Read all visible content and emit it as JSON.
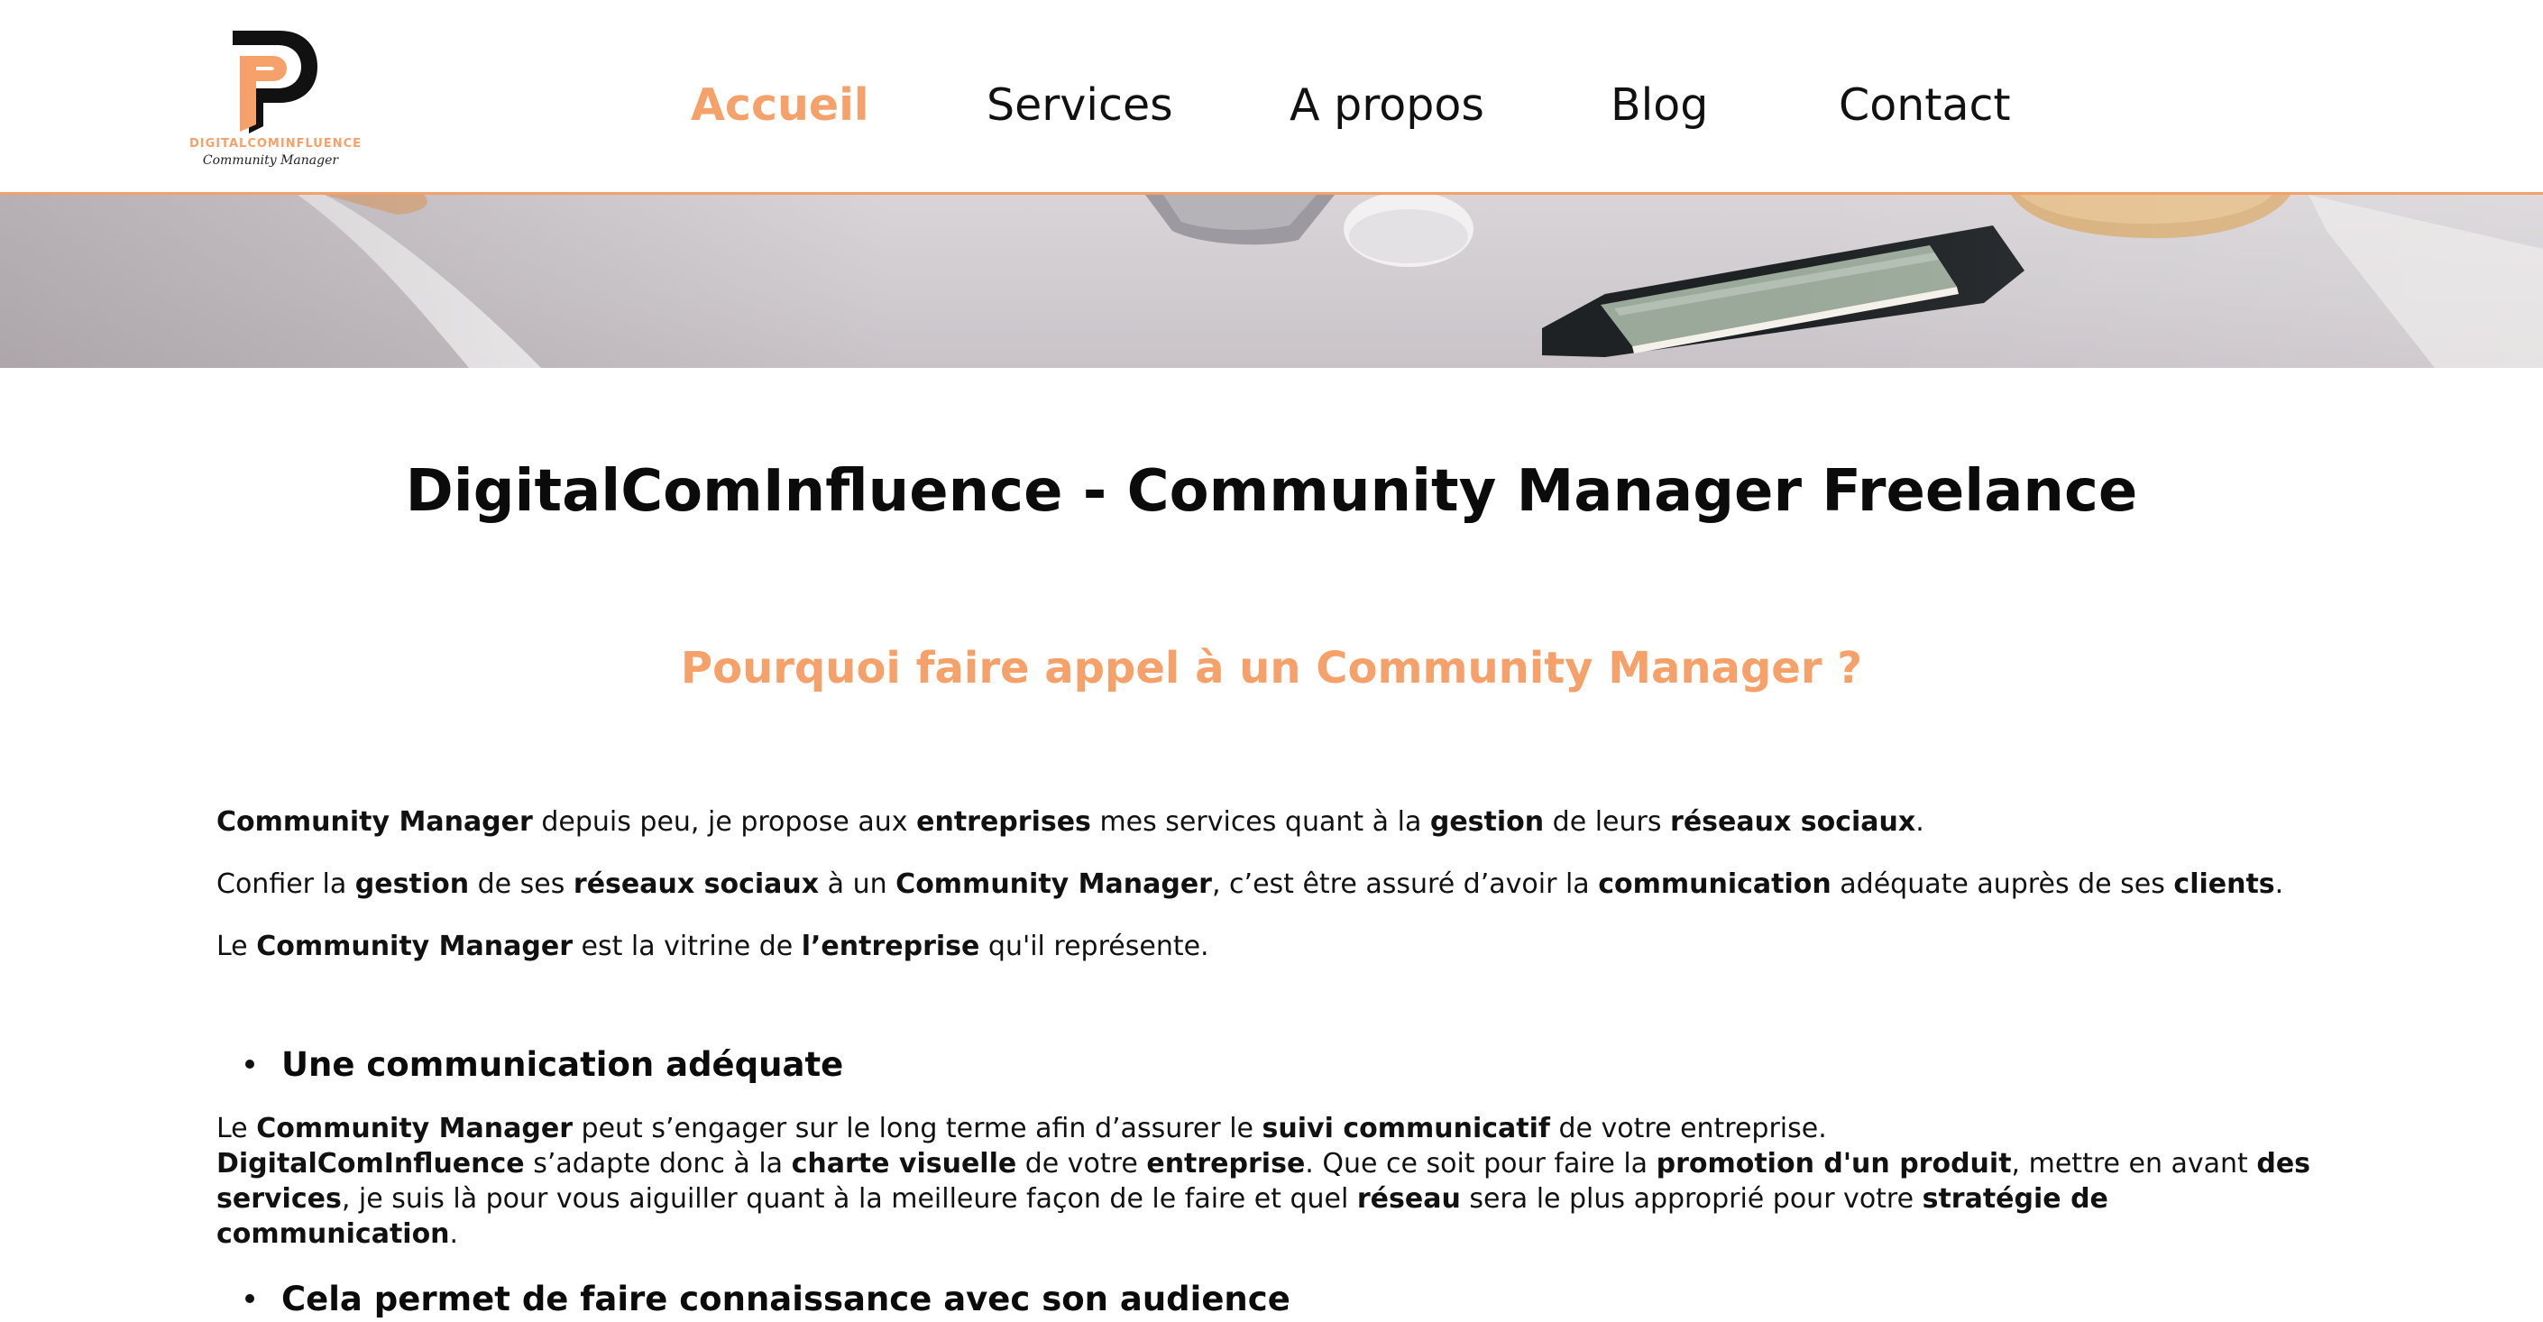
{
  "header": {
    "logo": {
      "brand": "DIGITALCOMINFLUENCE",
      "tagline": "Community Manager",
      "colors": {
        "primary": "#111111",
        "accent": "#f6a06a"
      }
    },
    "nav": [
      {
        "label": "Accueil",
        "active": true
      },
      {
        "label": "Services",
        "active": false
      },
      {
        "label": "A propos",
        "active": false
      },
      {
        "label": "Blog",
        "active": false
      },
      {
        "label": "Contact",
        "active": false
      }
    ]
  },
  "colors": {
    "accent": "#f6a06a",
    "text": "#111111",
    "background": "#ffffff"
  },
  "hero": {
    "image": "desk-photo-with-notebook-and-mouse"
  },
  "main": {
    "title": "DigitalComInfluence - Community Manager Freelance",
    "subtitle": "Pourquoi faire appel à un Community Manager ?",
    "intro": [
      [
        {
          "b": true,
          "t": "Community Manager"
        },
        {
          "b": false,
          "t": " depuis peu, je propose aux "
        },
        {
          "b": true,
          "t": "entreprises"
        },
        {
          "b": false,
          "t": " mes services quant à la "
        },
        {
          "b": true,
          "t": "gestion"
        },
        {
          "b": false,
          "t": " de leurs "
        },
        {
          "b": true,
          "t": "réseaux sociaux"
        },
        {
          "b": false,
          "t": "."
        }
      ],
      [
        {
          "b": false,
          "t": "Confier la "
        },
        {
          "b": true,
          "t": "gestion"
        },
        {
          "b": false,
          "t": " de ses "
        },
        {
          "b": true,
          "t": "réseaux sociaux"
        },
        {
          "b": false,
          "t": " à un "
        },
        {
          "b": true,
          "t": "Community Manager"
        },
        {
          "b": false,
          "t": ", c’est être assuré d’avoir la "
        },
        {
          "b": true,
          "t": "communication"
        },
        {
          "b": false,
          "t": " adéquate auprès de ses "
        },
        {
          "b": true,
          "t": "clients"
        },
        {
          "b": false,
          "t": "."
        }
      ],
      [
        {
          "b": false,
          "t": "Le "
        },
        {
          "b": true,
          "t": "Community Manager"
        },
        {
          "b": false,
          "t": " est la vitrine de "
        },
        {
          "b": true,
          "t": "l’entreprise"
        },
        {
          "b": false,
          "t": " qu'il représente."
        }
      ]
    ],
    "sections": [
      {
        "heading": "Une communication adéquate",
        "lines": [
          [
            {
              "b": false,
              "t": "Le "
            },
            {
              "b": true,
              "t": "Community Manager"
            },
            {
              "b": false,
              "t": " peut s’engager sur le long terme afin d’assurer le "
            },
            {
              "b": true,
              "t": "suivi communicatif"
            },
            {
              "b": false,
              "t": " de votre entreprise."
            }
          ],
          [
            {
              "b": true,
              "t": "DigitalComInfluence"
            },
            {
              "b": false,
              "t": " s’adapte donc à la "
            },
            {
              "b": true,
              "t": "charte visuelle"
            },
            {
              "b": false,
              "t": " de votre "
            },
            {
              "b": true,
              "t": "entreprise"
            },
            {
              "b": false,
              "t": ". Que ce soit pour faire la "
            },
            {
              "b": true,
              "t": "promotion d'un produit"
            },
            {
              "b": false,
              "t": ", mettre en avant "
            },
            {
              "b": true,
              "t": "des"
            }
          ],
          [
            {
              "b": true,
              "t": "services"
            },
            {
              "b": false,
              "t": ", je suis là pour vous aiguiller quant à la meilleure façon de le faire et quel "
            },
            {
              "b": true,
              "t": "réseau"
            },
            {
              "b": false,
              "t": " sera le plus approprié pour votre "
            },
            {
              "b": true,
              "t": "stratégie de"
            }
          ],
          [
            {
              "b": true,
              "t": "communication"
            },
            {
              "b": false,
              "t": "."
            }
          ]
        ]
      },
      {
        "heading": "Cela permet de faire connaissance avec son audience",
        "lines": []
      }
    ]
  }
}
